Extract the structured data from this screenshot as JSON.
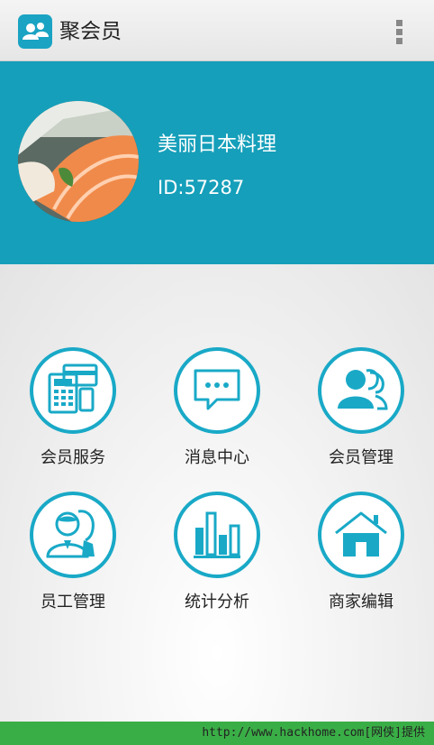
{
  "appbar": {
    "title": "聚会员",
    "app_icon": "members-group-icon",
    "overflow_icon": "overflow-menu-icon"
  },
  "profile": {
    "name": "美丽日本料理",
    "id_text": "ID:57287"
  },
  "menu": [
    {
      "label": "会员服务",
      "icon": "cash-register-card-icon"
    },
    {
      "label": "消息中心",
      "icon": "message-bubble-icon"
    },
    {
      "label": "会员管理",
      "icon": "members-icon"
    },
    {
      "label": "员工管理",
      "icon": "staff-icon"
    },
    {
      "label": "统计分析",
      "icon": "bar-chart-icon"
    },
    {
      "label": "商家编辑",
      "icon": "home-icon"
    }
  ],
  "watermark": "http://www.hackhome.com[网侠]提供",
  "colors": {
    "header": "#159fba",
    "accent": "#19a9c7",
    "footer": "#3aae46"
  }
}
